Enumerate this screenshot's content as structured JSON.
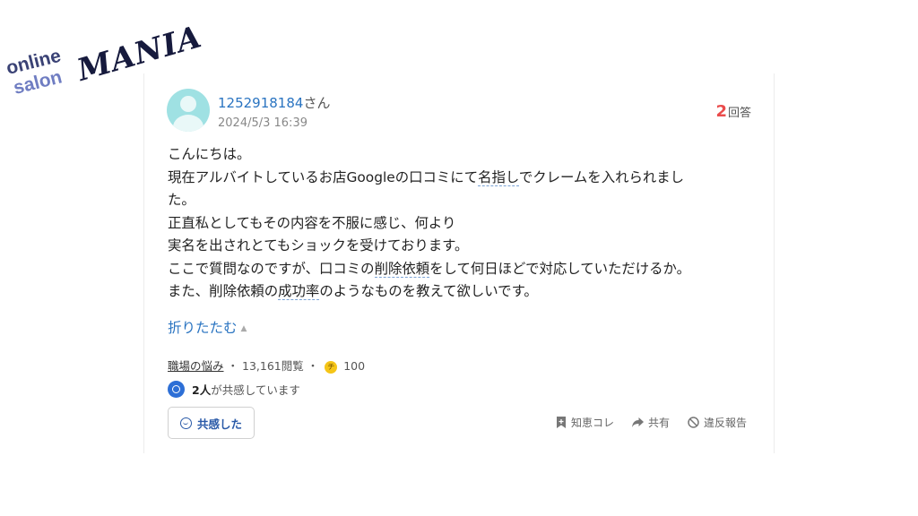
{
  "logo": {
    "online": "online",
    "salon": "salon",
    "mania": "MANIA"
  },
  "user": {
    "name": "1252918184",
    "suffix": "さん",
    "timestamp": "2024/5/3 16:39"
  },
  "answers": {
    "count": "2",
    "label": "回答"
  },
  "question": {
    "line1": "こんにちは。",
    "line2_a": "現在アルバイトしているお店Googleの口コミにて",
    "line2_kw": "名指し",
    "line2_b": "でクレームを入れられまし",
    "line3": "た。",
    "line4": "正直私としてもその内容を不服に感じ、何より",
    "line5": "実名を出されとてもショックを受けております。",
    "line6_a": "ここで質問なのですが、口コミの",
    "line6_kw": "削除依頼",
    "line6_b": "をして何日ほどで対応していただけるか。",
    "line7_a": "また、削除依頼の",
    "line7_kw": "成功率",
    "line7_b": "のようなものを教えて欲しいです。"
  },
  "collapse_label": "折りたたむ",
  "meta": {
    "category": "職場の悩み",
    "sep1": "・",
    "views": "13,161閲覧",
    "sep2": "・",
    "coin_icon_text": "チ",
    "coins": "100"
  },
  "empathy": {
    "count": "2人",
    "text": "が共感しています"
  },
  "empathy_button": "共感した",
  "actions": {
    "chie_kore": "知恵コレ",
    "share": "共有",
    "report": "違反報告"
  },
  "colors": {
    "link": "#2a74c1",
    "answer_count": "#ea4c4c",
    "avatar": "#9fe1e3",
    "coin": "#f5c518"
  }
}
